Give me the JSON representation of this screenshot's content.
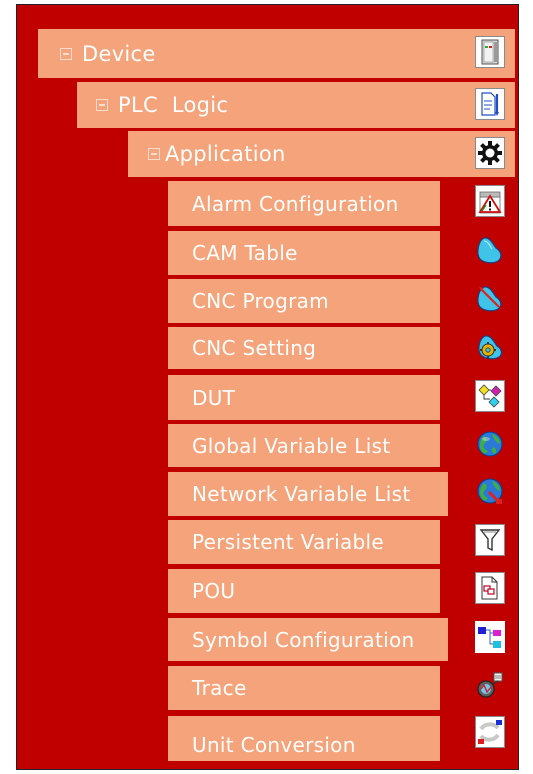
{
  "tree": {
    "device": {
      "label": "Device",
      "icon": "device-icon"
    },
    "plc_logic": {
      "label": "PLC  Logic",
      "icon": "plc-logic-icon"
    },
    "application": {
      "label": "Application",
      "icon": "gear-icon"
    },
    "items": [
      {
        "label": "Alarm Configuration",
        "icon": "alarm-warning-icon"
      },
      {
        "label": "CAM Table",
        "icon": "cam-table-icon"
      },
      {
        "label": "CNC Program",
        "icon": "cnc-program-icon"
      },
      {
        "label": "CNC Setting",
        "icon": "cnc-setting-icon"
      },
      {
        "label": "DUT",
        "icon": "dut-icon"
      },
      {
        "label": "Global Variable List",
        "icon": "globe-icon"
      },
      {
        "label": "Network Variable List",
        "icon": "network-globe-icon"
      },
      {
        "label": "Persistent Variable",
        "icon": "funnel-icon"
      },
      {
        "label": "POU",
        "icon": "pou-icon"
      },
      {
        "label": "Symbol Configuration",
        "icon": "symbol-config-icon"
      },
      {
        "label": "Trace",
        "icon": "trace-icon"
      },
      {
        "label": "Unit Conversion",
        "icon": "unit-conversion-icon"
      }
    ]
  },
  "colors": {
    "panel_bg": "#c00000",
    "row_bg": "#f4a37a",
    "text": "#ffffff"
  }
}
